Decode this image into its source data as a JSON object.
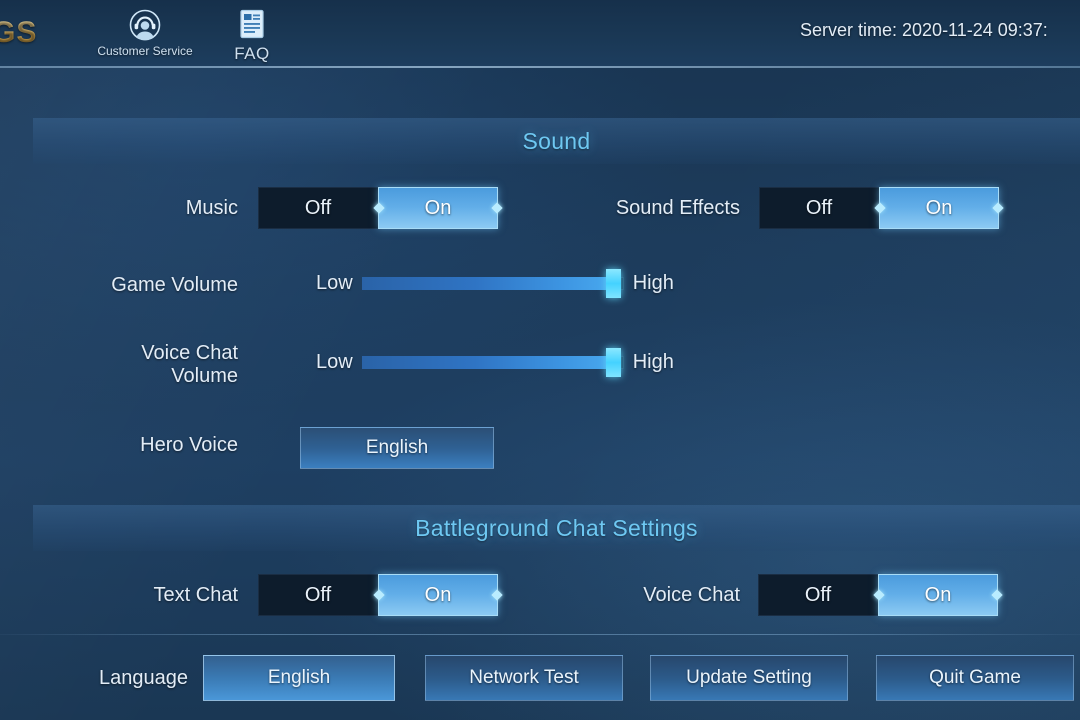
{
  "header": {
    "app_title": "GS",
    "customer_service": {
      "label": "Customer Service",
      "icon": "headset-avatar-icon"
    },
    "faq": {
      "label": "FAQ",
      "icon": "document-icon"
    },
    "server_time": "Server time: 2020-11-24 09:37:"
  },
  "sections": [
    {
      "title": "Sound"
    },
    {
      "title": "Battleground Chat Settings"
    }
  ],
  "sound": {
    "music": {
      "label": "Music",
      "off": "Off",
      "on": "On",
      "value": "On"
    },
    "sound_effects": {
      "label": "Sound Effects",
      "off": "Off",
      "on": "On",
      "value": "On"
    },
    "game_volume": {
      "label": "Game Volume",
      "low": "Low",
      "high": "High",
      "value": 96
    },
    "voice_chat_volume": {
      "label_line1": "Voice Chat",
      "label_line2": "Volume",
      "low": "Low",
      "high": "High",
      "value": 96
    },
    "hero_voice": {
      "label": "Hero Voice",
      "value": "English"
    }
  },
  "battleground_chat": {
    "text_chat": {
      "label": "Text Chat",
      "off": "Off",
      "on": "On",
      "value": "On"
    },
    "voice_chat": {
      "label": "Voice Chat",
      "off": "Off",
      "on": "On",
      "value": "On"
    }
  },
  "footer": {
    "language_label": "Language",
    "language_value": "English",
    "network_test": "Network Test",
    "update_setting": "Update Setting",
    "quit_game": "Quit Game"
  },
  "colors": {
    "accent_cyan": "#6ec8f2",
    "toggle_on": "#62aee8",
    "slider_handle": "#44d2ff",
    "title_gold": "#d9ae55",
    "background": "#1d3c5c"
  }
}
